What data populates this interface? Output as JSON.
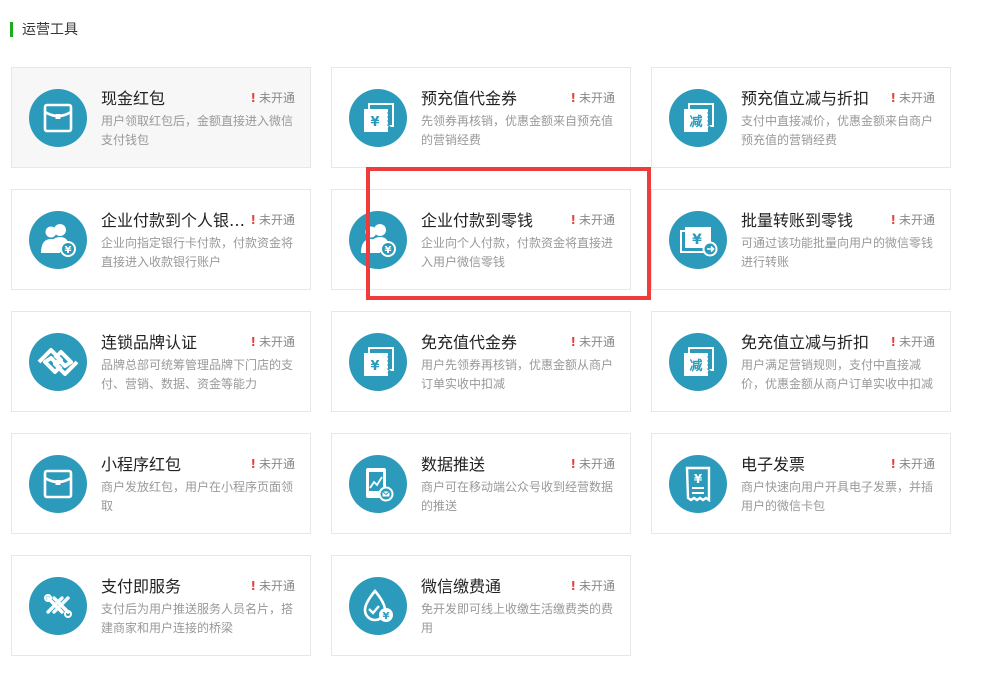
{
  "section": {
    "title": "运营工具"
  },
  "status_label": "未开通",
  "status_mark": "!",
  "colors": {
    "accent": "#1aad19",
    "icon_bg": "#2c9bbb",
    "alert": "#e64340",
    "highlight": "#ee3b3b"
  },
  "tools": [
    {
      "name": "现金红包",
      "desc": "用户领取红包后，金额直接进入微信支付钱包",
      "icon": "red-packet-icon"
    },
    {
      "name": "预充值代金券",
      "desc": "先领券再核销，优惠金额来自预充值的营销经费",
      "icon": "voucher-icon"
    },
    {
      "name": "预充值立减与折扣",
      "desc": "支付中直接减价，优惠金额来自商户预充值的营销经费",
      "icon": "discount-icon"
    },
    {
      "name": "企业付款到个人银…",
      "desc": "企业向指定银行卡付款，付款资金将直接进入收款银行账户",
      "icon": "users-payment-icon"
    },
    {
      "name": "企业付款到零钱",
      "desc": "企业向个人付款，付款资金将直接进入用户微信零钱",
      "icon": "users-payment-icon"
    },
    {
      "name": "批量转账到零钱",
      "desc": "可通过该功能批量向用户的微信零钱进行转账",
      "icon": "batch-transfer-icon"
    },
    {
      "name": "连锁品牌认证",
      "desc": "品牌总部可统筹管理品牌下门店的支付、营销、数据、资金等能力",
      "icon": "chain-brand-icon"
    },
    {
      "name": "免充值代金券",
      "desc": "用户先领券再核销，优惠金额从商户订单实收中扣减",
      "icon": "voucher-icon"
    },
    {
      "name": "免充值立减与折扣",
      "desc": "用户满足营销规则，支付中直接减价，优惠金额从商户订单实收中扣减",
      "icon": "discount-icon"
    },
    {
      "name": "小程序红包",
      "desc": "商户发放红包，用户在小程序页面领取",
      "icon": "red-packet-icon"
    },
    {
      "name": "数据推送",
      "desc": "商户可在移动端公众号收到经营数据的推送",
      "icon": "data-push-icon"
    },
    {
      "name": "电子发票",
      "desc": "商户快速向用户开具电子发票，并插用户的微信卡包",
      "icon": "invoice-icon"
    },
    {
      "name": "支付即服务",
      "desc": "支付后为用户推送服务人员名片，搭建商家和用户连接的桥梁",
      "icon": "service-link-icon"
    },
    {
      "name": "微信缴费通",
      "desc": "免开发即可线上收缴生活缴费类的费用",
      "icon": "bill-pay-icon"
    }
  ]
}
